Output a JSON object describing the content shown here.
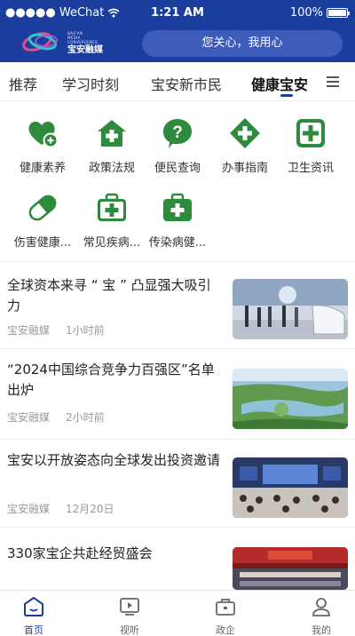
{
  "status_bar": {
    "carrier": "●●●●● WeChat",
    "time": "1:21 AM",
    "battery": "100%"
  },
  "header": {
    "logo_line1": "BAO'AN",
    "logo_line2": "MEDIA CONVERGENCE",
    "logo_name": "宝安融媒",
    "search_placeholder": "您关心，我用心"
  },
  "tabs": [
    {
      "label": "推荐",
      "active": false
    },
    {
      "label": "学习时刻",
      "active": false
    },
    {
      "label": "宝安新市民",
      "active": false
    },
    {
      "label": "健康宝安",
      "active": true
    }
  ],
  "services": [
    {
      "label": "健康素养",
      "icon": "heart-plus-icon"
    },
    {
      "label": "政策法规",
      "icon": "house-plus-icon"
    },
    {
      "label": "便民查询",
      "icon": "question-bubble-icon"
    },
    {
      "label": "办事指南",
      "icon": "diamond-plus-icon"
    },
    {
      "label": "卫生资讯",
      "icon": "square-plus-icon"
    },
    {
      "label": "伤害健康...",
      "icon": "pill-icon"
    },
    {
      "label": "常见疾病...",
      "icon": "medkit-icon"
    },
    {
      "label": "传染病健...",
      "icon": "medkit-icon"
    }
  ],
  "news": [
    {
      "title": "全球资本来寻 “ 宝 ” 凸显强大吸引力",
      "source": "宝安融媒",
      "time": "1小时前"
    },
    {
      "title": "“2024中国综合竞争力百强区”名单出炉",
      "source": "宝安融媒",
      "time": "2小时前"
    },
    {
      "title": "宝安以开放姿态向全球发出投资邀请",
      "source": "宝安融媒",
      "time": "12月20日"
    },
    {
      "title": "330家宝企共赴经贸盛会",
      "source": "",
      "time": ""
    }
  ],
  "bottom_nav": [
    {
      "label": "首页",
      "active": true
    },
    {
      "label": "视听",
      "active": false
    },
    {
      "label": "政企",
      "active": false
    },
    {
      "label": "我的",
      "active": false
    }
  ],
  "colors": {
    "brand_blue": "#1b3d9e",
    "icon_green": "#2e8b3d"
  }
}
